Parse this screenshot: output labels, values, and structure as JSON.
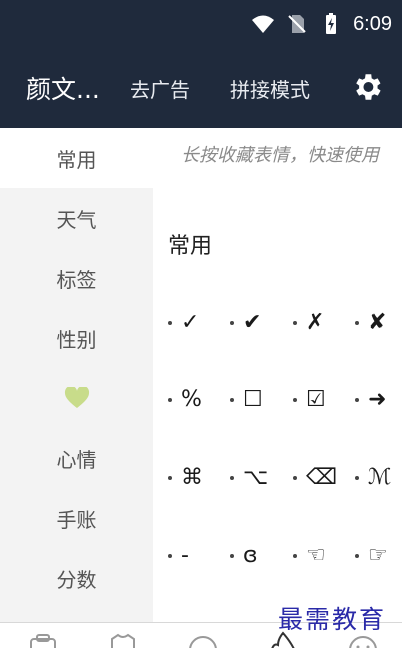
{
  "status_bar": {
    "time": "6:09",
    "icons": [
      "wifi-icon",
      "no-sim-icon",
      "battery-charging-icon"
    ]
  },
  "app_bar": {
    "title": "颜文...",
    "actions": [
      {
        "label": "去广告"
      },
      {
        "label": "拼接模式"
      }
    ],
    "settings_icon": "gear-icon"
  },
  "sidebar": {
    "items": [
      {
        "label": "常用",
        "active": true
      },
      {
        "label": "天气"
      },
      {
        "label": "标签"
      },
      {
        "label": "性别"
      },
      {
        "label": "",
        "icon": "heart-icon"
      },
      {
        "label": "心情"
      },
      {
        "label": "手账"
      },
      {
        "label": "分数"
      }
    ]
  },
  "content": {
    "hint": "长按收藏表情，快速使用",
    "section_title": "常用",
    "rows": [
      [
        "✓",
        "✔",
        "✗",
        "✘"
      ],
      [
        "%",
        "☐",
        "☑",
        "➜"
      ],
      [
        "⌘",
        "⌥",
        "⌫",
        "ℳ"
      ],
      [
        "-",
        "ɞ",
        "☜",
        "☞"
      ]
    ]
  },
  "bottom_nav": {
    "icons": [
      "clipboard-icon",
      "shirt-icon",
      "circle-icon",
      "fire-icon",
      "smile-icon"
    ]
  },
  "watermark": "最需教育",
  "colors": {
    "header": "#1f2a3c",
    "sidebar": "#f3f3f3",
    "heart": "#c8dc8a",
    "watermark": "#2a2aa8"
  }
}
